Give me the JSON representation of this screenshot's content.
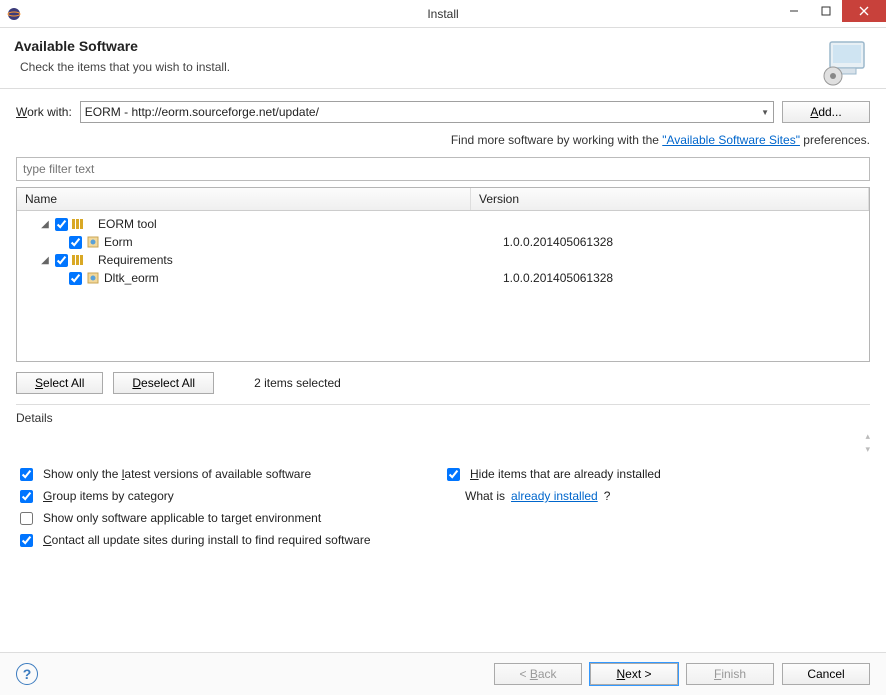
{
  "window": {
    "title": "Install"
  },
  "header": {
    "title": "Available Software",
    "subtitle": "Check the items that you wish to install."
  },
  "workwith": {
    "label_pre": "W",
    "label_mid": "ork with:",
    "value": "EORM - http://eorm.sourceforge.net/update/",
    "add_label": "Add..."
  },
  "hint": {
    "prefix": "Find more software by working with the ",
    "link": "\"Available Software Sites\"",
    "suffix": " preferences."
  },
  "filter": {
    "placeholder": "type filter text"
  },
  "table": {
    "columns": {
      "name": "Name",
      "version": "Version"
    },
    "rows": [
      {
        "type": "category",
        "name": "EORM tool",
        "checked": true
      },
      {
        "type": "feature",
        "name": "Eorm",
        "version": "1.0.0.201405061328",
        "checked": true
      },
      {
        "type": "category",
        "name": "Requirements",
        "checked": true
      },
      {
        "type": "feature",
        "name": "Dltk_eorm",
        "version": "1.0.0.201405061328",
        "checked": true
      }
    ]
  },
  "selection": {
    "select_all": "Select All",
    "deselect_all": "Deselect All",
    "status": "2 items selected"
  },
  "details": {
    "label": "Details"
  },
  "options": {
    "latest": "Show only the latest versions of available software",
    "group": "Group items by category",
    "target": "Show only software applicable to target environment",
    "contact": "Contact all update sites during install to find required software",
    "hide": "Hide items that are already installed",
    "whatis_pre": "What is ",
    "whatis_link": "already installed",
    "whatis_suf": "?"
  },
  "footer": {
    "back": "< Back",
    "next": "Next >",
    "finish": "Finish",
    "cancel": "Cancel"
  }
}
